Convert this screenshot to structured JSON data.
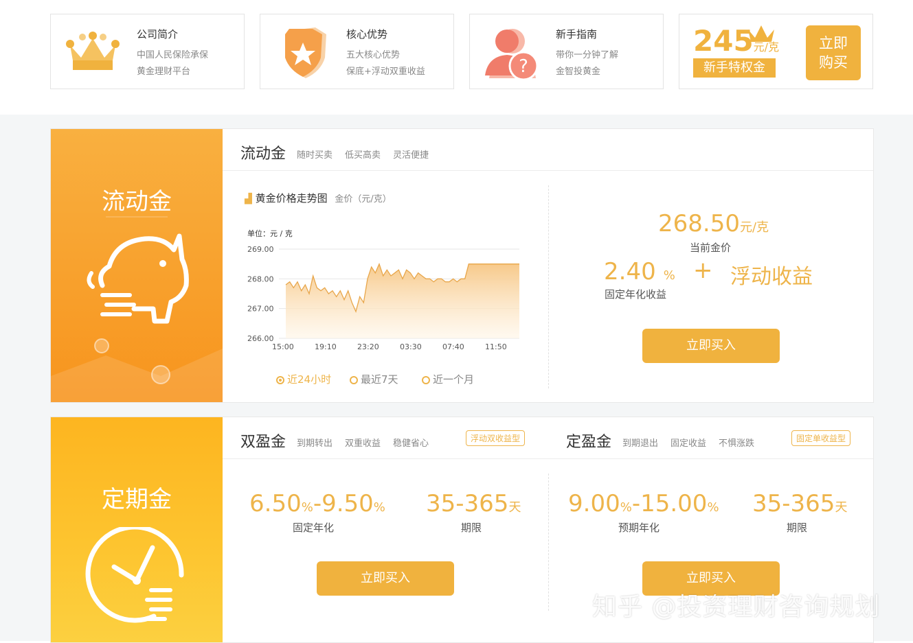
{
  "top_cards": [
    {
      "title": "公司简介",
      "line1": "中国人民保险承保",
      "line2": "黄金理财平台",
      "icon": "crown-icon"
    },
    {
      "title": "核心优势",
      "line1": "五大核心优势",
      "line2": "保底+浮动双重收益",
      "icon": "shield-star-icon"
    },
    {
      "title": "新手指南",
      "line1": "带你一分钟了解",
      "line2": "金智投黄金",
      "icon": "user-question-icon"
    }
  ],
  "promo": {
    "amount": "245",
    "unit": "元/克",
    "label": "新手特权金",
    "button": "立即购买"
  },
  "liudong": {
    "side_title": "流动金",
    "title": "流动金",
    "tags": [
      "随时买卖",
      "低买高卖",
      "灵活便捷"
    ],
    "chart_title": "黄金价格走势图",
    "chart_unit_note": "金价（元/克）",
    "price": "268.50",
    "price_unit": "元/克",
    "price_label": "当前金价",
    "rate": "2.40",
    "rate_unit": "%",
    "plus": "+",
    "float_label": "浮动收益",
    "rate_label": "固定年化收益",
    "buy": "立即买入",
    "ranges": [
      {
        "label": "近24小时",
        "selected": true
      },
      {
        "label": "最近7天",
        "selected": false
      },
      {
        "label": "近一个月",
        "selected": false
      }
    ]
  },
  "chart_data": {
    "type": "area",
    "title": "",
    "ylabel": "单位：元 / 克",
    "ylim": [
      266.0,
      269.0
    ],
    "yticks": [
      "269.00",
      "268.00",
      "267.00",
      "266.00"
    ],
    "xticks": [
      "15:00",
      "19:10",
      "23:20",
      "03:30",
      "07:40",
      "11:50"
    ],
    "series": [
      {
        "values": [
          267.8,
          267.9,
          267.7,
          267.9,
          267.6,
          267.8,
          267.5,
          268.1,
          267.7,
          267.6,
          267.7,
          267.5,
          267.6,
          267.4,
          267.6,
          267.3,
          267.6,
          267.2,
          266.9,
          267.4,
          267.2,
          268.0,
          268.4,
          268.2,
          268.5,
          268.1,
          268.3,
          268.1,
          268.2,
          268.3,
          268.0,
          268.3,
          268.2,
          268.0,
          268.2,
          268.1,
          268.0,
          268.0,
          267.9,
          268.0,
          268.0,
          267.9,
          267.9,
          268.0,
          267.9,
          268.0,
          268.0,
          268.5,
          268.5,
          268.5,
          268.5,
          268.5,
          268.5,
          268.5,
          268.5,
          268.5,
          268.5,
          268.5,
          268.5,
          268.5,
          268.5
        ]
      }
    ],
    "colors": {
      "line": "#e8a64a",
      "fill": "#f7c98a"
    }
  },
  "dingqi": {
    "side_title": "定期金",
    "products": [
      {
        "title": "双盈金",
        "tags": [
          "到期转出",
          "双重收益",
          "稳健省心"
        ],
        "badge": "浮动双收益型",
        "rate_low": "6.50",
        "rate_high": "9.50",
        "pct": "%",
        "dash": "-",
        "rate_label": "固定年化",
        "term": "35-365",
        "term_unit": "天",
        "term_label": "期限",
        "buy": "立即买入"
      },
      {
        "title": "定盈金",
        "tags": [
          "到期退出",
          "固定收益",
          "不惧涨跌"
        ],
        "badge": "固定单收益型",
        "rate_low": "9.00",
        "rate_high": "15.00",
        "pct": "%",
        "dash": "-",
        "rate_label": "预期年化",
        "term": "35-365",
        "term_unit": "天",
        "term_label": "期限",
        "buy": "立即买入"
      }
    ]
  },
  "watermark": "知乎 @投资理财咨询规划",
  "colors": {
    "accent": "#eeb44a",
    "button": "#f0b23e",
    "orange": "#f7941d",
    "yellow": "#fdc02f"
  }
}
